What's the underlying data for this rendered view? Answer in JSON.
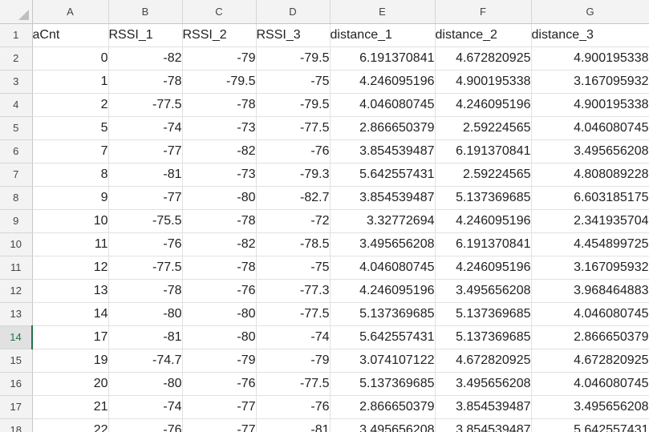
{
  "columns": [
    "A",
    "B",
    "C",
    "D",
    "E",
    "F",
    "G"
  ],
  "active_row": "14",
  "headers": [
    "aCnt",
    "RSSI_1",
    "RSSI_2",
    "RSSI_3",
    "distance_1",
    "distance_2",
    "distance_3"
  ],
  "rows": [
    {
      "num": "2",
      "cells": [
        "0",
        "-82",
        "-79",
        "-79.5",
        "6.191370841",
        "4.672820925",
        "4.900195338"
      ]
    },
    {
      "num": "3",
      "cells": [
        "1",
        "-78",
        "-79.5",
        "-75",
        "4.246095196",
        "4.900195338",
        "3.167095932"
      ]
    },
    {
      "num": "4",
      "cells": [
        "2",
        "-77.5",
        "-78",
        "-79.5",
        "4.046080745",
        "4.246095196",
        "4.900195338"
      ]
    },
    {
      "num": "5",
      "cells": [
        "5",
        "-74",
        "-73",
        "-77.5",
        "2.866650379",
        "2.59224565",
        "4.046080745"
      ]
    },
    {
      "num": "6",
      "cells": [
        "7",
        "-77",
        "-82",
        "-76",
        "3.854539487",
        "6.191370841",
        "3.495656208"
      ]
    },
    {
      "num": "7",
      "cells": [
        "8",
        "-81",
        "-73",
        "-79.3",
        "5.642557431",
        "2.59224565",
        "4.808089228"
      ]
    },
    {
      "num": "8",
      "cells": [
        "9",
        "-77",
        "-80",
        "-82.7",
        "3.854539487",
        "5.137369685",
        "6.603185175"
      ]
    },
    {
      "num": "9",
      "cells": [
        "10",
        "-75.5",
        "-78",
        "-72",
        "3.32772694",
        "4.246095196",
        "2.341935704"
      ]
    },
    {
      "num": "10",
      "cells": [
        "11",
        "-76",
        "-82",
        "-78.5",
        "3.495656208",
        "6.191370841",
        "4.454899725"
      ]
    },
    {
      "num": "11",
      "cells": [
        "12",
        "-77.5",
        "-78",
        "-75",
        "4.046080745",
        "4.246095196",
        "3.167095932"
      ]
    },
    {
      "num": "12",
      "cells": [
        "13",
        "-78",
        "-76",
        "-77.3",
        "4.246095196",
        "3.495656208",
        "3.968464883"
      ]
    },
    {
      "num": "13",
      "cells": [
        "14",
        "-80",
        "-80",
        "-77.5",
        "5.137369685",
        "5.137369685",
        "4.046080745"
      ]
    },
    {
      "num": "14",
      "cells": [
        "17",
        "-81",
        "-80",
        "-74",
        "5.642557431",
        "5.137369685",
        "2.866650379"
      ]
    },
    {
      "num": "15",
      "cells": [
        "19",
        "-74.7",
        "-79",
        "-79",
        "3.074107122",
        "4.672820925",
        "4.672820925"
      ]
    },
    {
      "num": "16",
      "cells": [
        "20",
        "-80",
        "-76",
        "-77.5",
        "5.137369685",
        "3.495656208",
        "4.046080745"
      ]
    },
    {
      "num": "17",
      "cells": [
        "21",
        "-74",
        "-77",
        "-76",
        "2.866650379",
        "3.854539487",
        "3.495656208"
      ]
    },
    {
      "num": "18",
      "cells": [
        "22",
        "-76",
        "-77",
        "-81",
        "3.495656208",
        "3.854539487",
        "5.642557431"
      ]
    }
  ]
}
